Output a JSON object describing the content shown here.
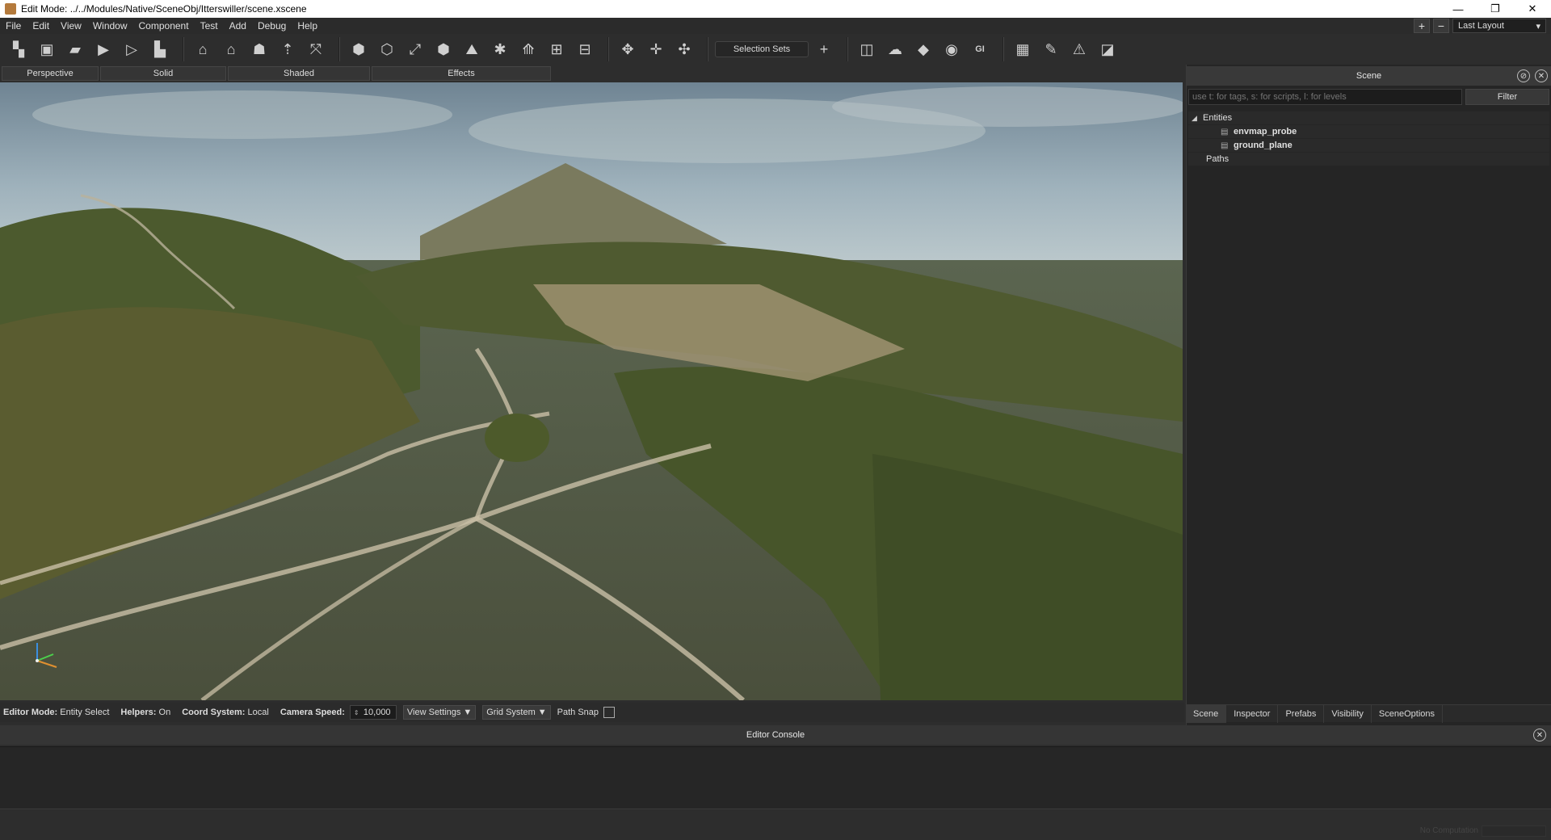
{
  "window": {
    "title": "Edit Mode: ../../Modules/Native/SceneObj/Itterswiller/scene.xscene",
    "minimize": "—",
    "restore": "❐",
    "close": "✕"
  },
  "menu": {
    "items": [
      "File",
      "Edit",
      "View",
      "Window",
      "Component",
      "Test",
      "Add",
      "Debug",
      "Help"
    ],
    "plus": "+",
    "minus": "−",
    "layout": "Last Layout"
  },
  "toolbar": {
    "selection_sets": "Selection Sets",
    "add": "+",
    "gi": "GI"
  },
  "view_tabs": [
    "Perspective",
    "Solid",
    "Shaded",
    "Effects"
  ],
  "scene_panel": {
    "title": "Scene",
    "search_placeholder": "use t: for tags, s: for scripts, l: for levels",
    "filter": "Filter",
    "tree": {
      "entities": "Entities",
      "children": [
        "envmap_probe",
        "ground_plane"
      ],
      "paths": "Paths"
    },
    "tabs": [
      "Scene",
      "Inspector",
      "Prefabs",
      "Visibility",
      "SceneOptions"
    ],
    "active_tab": "Scene"
  },
  "status": {
    "editor_mode_label": "Editor Mode:",
    "editor_mode_value": "Entity Select",
    "helpers_label": "Helpers:",
    "helpers_value": "On",
    "coord_label": "Coord System:",
    "coord_value": "Local",
    "speed_label": "Camera Speed:",
    "speed_value": "10,000",
    "view_settings": "View Settings",
    "grid_system": "Grid System",
    "path_snap": "Path Snap"
  },
  "console": {
    "title": "Editor Console",
    "computation": "No Computation"
  }
}
